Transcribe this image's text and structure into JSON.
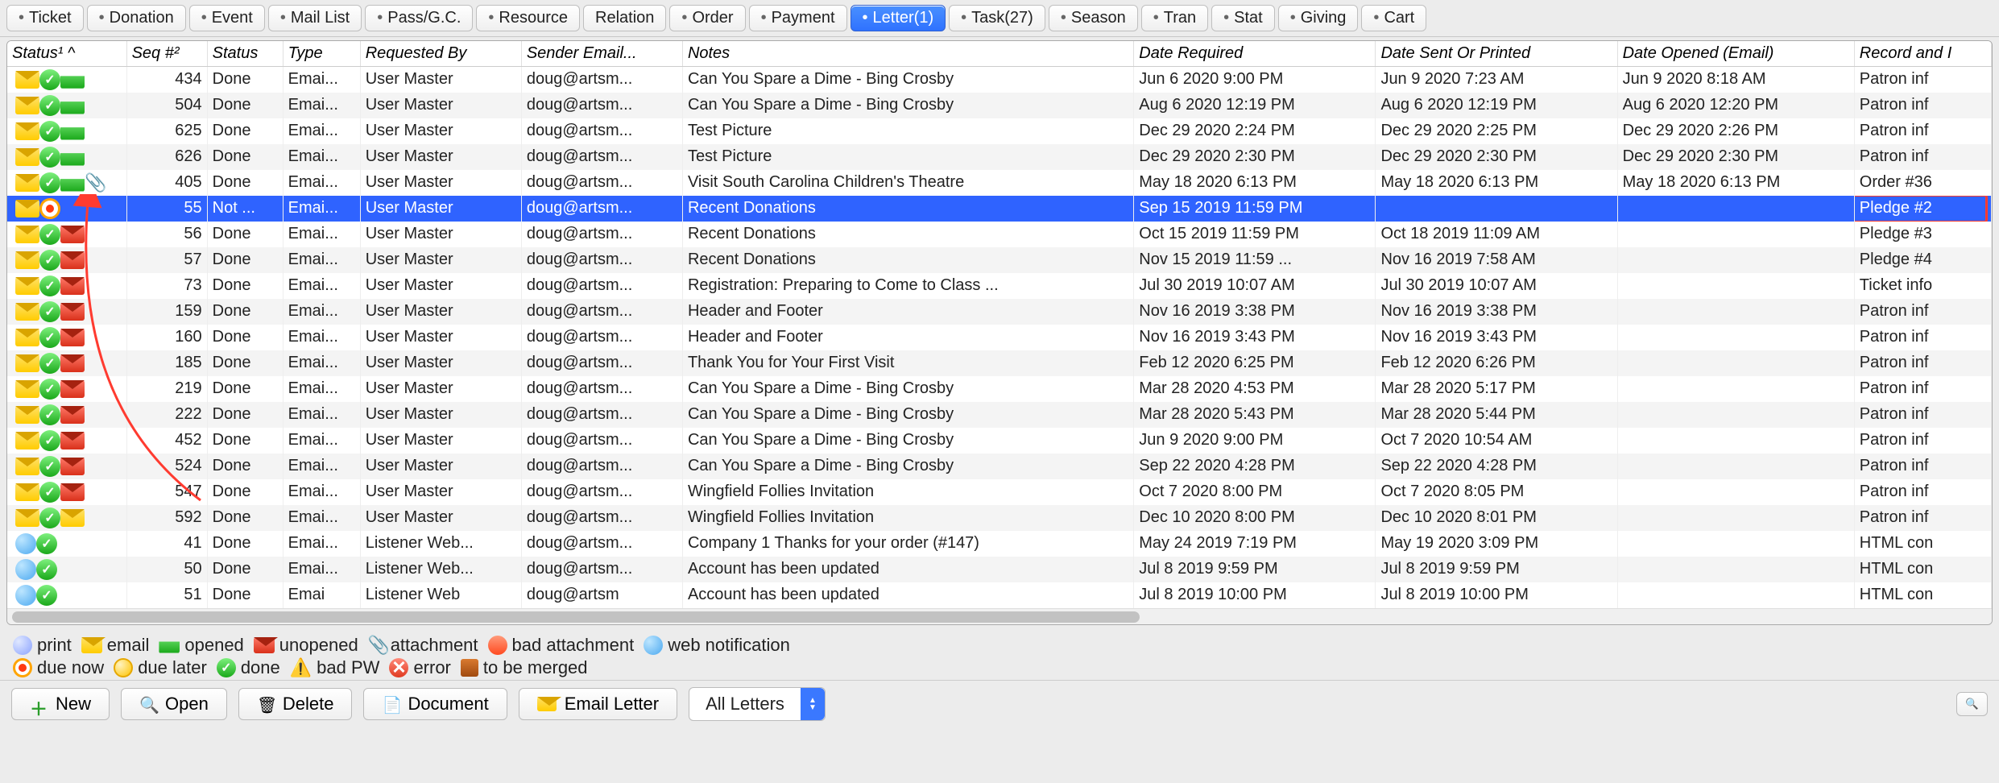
{
  "tabs": [
    {
      "label": "Ticket",
      "dot": true
    },
    {
      "label": "Donation",
      "dot": true
    },
    {
      "label": "Event",
      "dot": true
    },
    {
      "label": "Mail List",
      "dot": true
    },
    {
      "label": "Pass/G.C.",
      "dot": true
    },
    {
      "label": "Resource",
      "dot": true
    },
    {
      "label": "Relation",
      "dot": false
    },
    {
      "label": "Order",
      "dot": true
    },
    {
      "label": "Payment",
      "dot": true
    },
    {
      "label": "Letter(1)",
      "dot": true,
      "active": true
    },
    {
      "label": "Task(27)",
      "dot": true
    },
    {
      "label": "Season",
      "dot": true
    },
    {
      "label": "Tran",
      "dot": true
    },
    {
      "label": "Stat",
      "dot": true
    },
    {
      "label": "Giving",
      "dot": true
    },
    {
      "label": "Cart",
      "dot": true
    }
  ],
  "columns": {
    "status1": "Status¹  ^",
    "seq": "Seq #²",
    "status": "Status",
    "type": "Type",
    "reqby": "Requested By",
    "sender": "Sender Email...",
    "notes": "Notes",
    "datereq": "Date Required",
    "datesent": "Date Sent Or Printed",
    "dateopen": "Date Opened (Email)",
    "record": "Record and I"
  },
  "rows": [
    {
      "icons": [
        "envelope",
        "check",
        "opened"
      ],
      "seq": "434",
      "status": "Done",
      "type": "Emai...",
      "reqby": "User Master",
      "sender": "doug@artsm...",
      "notes": "Can You Spare a Dime - Bing Crosby",
      "datereq": "Jun 6 2020 9:00 PM",
      "datesent": "Jun 9 2020 7:23 AM",
      "dateopen": "Jun 9 2020 8:18 AM",
      "record": "Patron inf"
    },
    {
      "icons": [
        "envelope",
        "check",
        "opened"
      ],
      "seq": "504",
      "status": "Done",
      "type": "Emai...",
      "reqby": "User Master",
      "sender": "doug@artsm...",
      "notes": "Can You Spare a Dime - Bing Crosby",
      "datereq": "Aug 6 2020 12:19 PM",
      "datesent": "Aug 6 2020 12:19 PM",
      "dateopen": "Aug 6 2020 12:20 PM",
      "record": "Patron inf"
    },
    {
      "icons": [
        "envelope",
        "check",
        "opened"
      ],
      "seq": "625",
      "status": "Done",
      "type": "Emai...",
      "reqby": "User Master",
      "sender": "doug@artsm...",
      "notes": "Test Picture",
      "datereq": "Dec 29 2020 2:24 PM",
      "datesent": "Dec 29 2020 2:25 PM",
      "dateopen": "Dec 29 2020 2:26 PM",
      "record": "Patron inf"
    },
    {
      "icons": [
        "envelope",
        "check",
        "opened"
      ],
      "seq": "626",
      "status": "Done",
      "type": "Emai...",
      "reqby": "User Master",
      "sender": "doug@artsm...",
      "notes": "Test Picture",
      "datereq": "Dec 29 2020 2:30 PM",
      "datesent": "Dec 29 2020 2:30 PM",
      "dateopen": "Dec 29 2020 2:30 PM",
      "record": "Patron inf"
    },
    {
      "icons": [
        "envelope",
        "check",
        "opened",
        "attach"
      ],
      "seq": "405",
      "status": "Done",
      "type": "Emai...",
      "reqby": "User Master",
      "sender": "doug@artsm...",
      "notes": "Visit South Carolina Children's Theatre",
      "datereq": "May 18 2020 6:13 PM",
      "datesent": "May 18 2020 6:13 PM",
      "dateopen": "May 18 2020 6:13 PM",
      "record": "Order #36"
    },
    {
      "icons": [
        "envelope",
        "due"
      ],
      "seq": "55",
      "status": "Not ...",
      "type": "Emai...",
      "reqby": "User Master",
      "sender": "doug@artsm...",
      "notes": "Recent Donations",
      "datereq": "Sep 15 2019 11:59 PM",
      "datesent": "",
      "dateopen": "",
      "record": "Pledge #2",
      "selected": true,
      "highlight": true
    },
    {
      "icons": [
        "envelope",
        "check",
        "unopened"
      ],
      "seq": "56",
      "status": "Done",
      "type": "Emai...",
      "reqby": "User Master",
      "sender": "doug@artsm...",
      "notes": "Recent Donations",
      "datereq": "Oct 15 2019 11:59 PM",
      "datesent": "Oct 18 2019 11:09 AM",
      "dateopen": "",
      "record": "Pledge #3"
    },
    {
      "icons": [
        "envelope",
        "check",
        "unopened"
      ],
      "seq": "57",
      "status": "Done",
      "type": "Emai...",
      "reqby": "User Master",
      "sender": "doug@artsm...",
      "notes": "Recent Donations",
      "datereq": "Nov 15 2019 11:59 ...",
      "datesent": "Nov 16 2019 7:58 AM",
      "dateopen": "",
      "record": "Pledge #4"
    },
    {
      "icons": [
        "envelope",
        "check",
        "unopened"
      ],
      "seq": "73",
      "status": "Done",
      "type": "Emai...",
      "reqby": "User Master",
      "sender": "doug@artsm...",
      "notes": "Registration: Preparing to Come to Class ...",
      "datereq": "Jul 30 2019 10:07 AM",
      "datesent": "Jul 30 2019 10:07 AM",
      "dateopen": "",
      "record": "Ticket info"
    },
    {
      "icons": [
        "envelope",
        "check",
        "unopened"
      ],
      "seq": "159",
      "status": "Done",
      "type": "Emai...",
      "reqby": "User Master",
      "sender": "doug@artsm...",
      "notes": "Header and Footer",
      "datereq": "Nov 16 2019 3:38 PM",
      "datesent": "Nov 16 2019 3:38 PM",
      "dateopen": "",
      "record": "Patron inf"
    },
    {
      "icons": [
        "envelope",
        "check",
        "unopened"
      ],
      "seq": "160",
      "status": "Done",
      "type": "Emai...",
      "reqby": "User Master",
      "sender": "doug@artsm...",
      "notes": "Header and Footer",
      "datereq": "Nov 16 2019 3:43 PM",
      "datesent": "Nov 16 2019 3:43 PM",
      "dateopen": "",
      "record": "Patron inf"
    },
    {
      "icons": [
        "envelope",
        "check",
        "unopened"
      ],
      "seq": "185",
      "status": "Done",
      "type": "Emai...",
      "reqby": "User Master",
      "sender": "doug@artsm...",
      "notes": "Thank You for Your First Visit",
      "datereq": "Feb 12 2020 6:25 PM",
      "datesent": "Feb 12 2020 6:26 PM",
      "dateopen": "",
      "record": "Patron inf"
    },
    {
      "icons": [
        "envelope",
        "check",
        "unopened"
      ],
      "seq": "219",
      "status": "Done",
      "type": "Emai...",
      "reqby": "User Master",
      "sender": "doug@artsm...",
      "notes": "Can You Spare a Dime - Bing Crosby",
      "datereq": "Mar 28 2020 4:53 PM",
      "datesent": "Mar 28 2020 5:17 PM",
      "dateopen": "",
      "record": "Patron inf"
    },
    {
      "icons": [
        "envelope",
        "check",
        "unopened"
      ],
      "seq": "222",
      "status": "Done",
      "type": "Emai...",
      "reqby": "User Master",
      "sender": "doug@artsm...",
      "notes": "Can You Spare a Dime - Bing Crosby",
      "datereq": "Mar 28 2020 5:43 PM",
      "datesent": "Mar 28 2020 5:44 PM",
      "dateopen": "",
      "record": "Patron inf"
    },
    {
      "icons": [
        "envelope",
        "check",
        "unopened"
      ],
      "seq": "452",
      "status": "Done",
      "type": "Emai...",
      "reqby": "User Master",
      "sender": "doug@artsm...",
      "notes": "Can You Spare a Dime - Bing Crosby",
      "datereq": "Jun 9 2020 9:00 PM",
      "datesent": "Oct 7 2020 10:54 AM",
      "dateopen": "",
      "record": "Patron inf"
    },
    {
      "icons": [
        "envelope",
        "check",
        "unopened"
      ],
      "seq": "524",
      "status": "Done",
      "type": "Emai...",
      "reqby": "User Master",
      "sender": "doug@artsm...",
      "notes": "Can You Spare a Dime - Bing Crosby",
      "datereq": "Sep 22 2020 4:28 PM",
      "datesent": "Sep 22 2020 4:28 PM",
      "dateopen": "",
      "record": "Patron inf"
    },
    {
      "icons": [
        "envelope",
        "check",
        "unopened"
      ],
      "seq": "547",
      "status": "Done",
      "type": "Emai...",
      "reqby": "User Master",
      "sender": "doug@artsm...",
      "notes": "Wingfield Follies Invitation",
      "datereq": "Oct 7 2020 8:00 PM",
      "datesent": "Oct 7 2020 8:05 PM",
      "dateopen": "",
      "record": "Patron inf"
    },
    {
      "icons": [
        "envelope",
        "check",
        "envelope"
      ],
      "seq": "592",
      "status": "Done",
      "type": "Emai...",
      "reqby": "User Master",
      "sender": "doug@artsm...",
      "notes": "Wingfield Follies Invitation",
      "datereq": "Dec 10 2020 8:00 PM",
      "datesent": "Dec 10 2020 8:01 PM",
      "dateopen": "",
      "record": "Patron inf"
    },
    {
      "icons": [
        "web",
        "check"
      ],
      "seq": "41",
      "status": "Done",
      "type": "Emai...",
      "reqby": "Listener Web...",
      "sender": "doug@artsm...",
      "notes": "Company 1 Thanks for your order (#147)",
      "datereq": "May 24 2019 7:19 PM",
      "datesent": "May 19 2020 3:09 PM",
      "dateopen": "",
      "record": "HTML con"
    },
    {
      "icons": [
        "web",
        "check"
      ],
      "seq": "50",
      "status": "Done",
      "type": "Emai...",
      "reqby": "Listener Web...",
      "sender": "doug@artsm...",
      "notes": "Account has been updated",
      "datereq": "Jul 8 2019 9:59 PM",
      "datesent": "Jul 8 2019 9:59 PM",
      "dateopen": "",
      "record": "HTML con"
    },
    {
      "icons": [
        "web",
        "check"
      ],
      "seq": "51",
      "status": "Done",
      "type": "Emai",
      "reqby": "Listener Web",
      "sender": "doug@artsm",
      "notes": "Account has been updated",
      "datereq": "Jul 8 2019 10:00 PM",
      "datesent": "Jul 8 2019 10:00 PM",
      "dateopen": "",
      "record": "HTML con"
    }
  ],
  "legend": {
    "print": "print",
    "email": "email",
    "opened": "opened",
    "unopened": "unopened",
    "attachment": "attachment",
    "bad_attachment": "bad attachment",
    "web": "web notification",
    "due_now": "due now",
    "due_later": "due later",
    "done": "done",
    "bad_pw": "bad PW",
    "error": "error",
    "merged": "to be merged"
  },
  "toolbar": {
    "new": "New",
    "open": "Open",
    "delete": "Delete",
    "document": "Document",
    "email": "Email Letter",
    "filter": "All Letters"
  }
}
